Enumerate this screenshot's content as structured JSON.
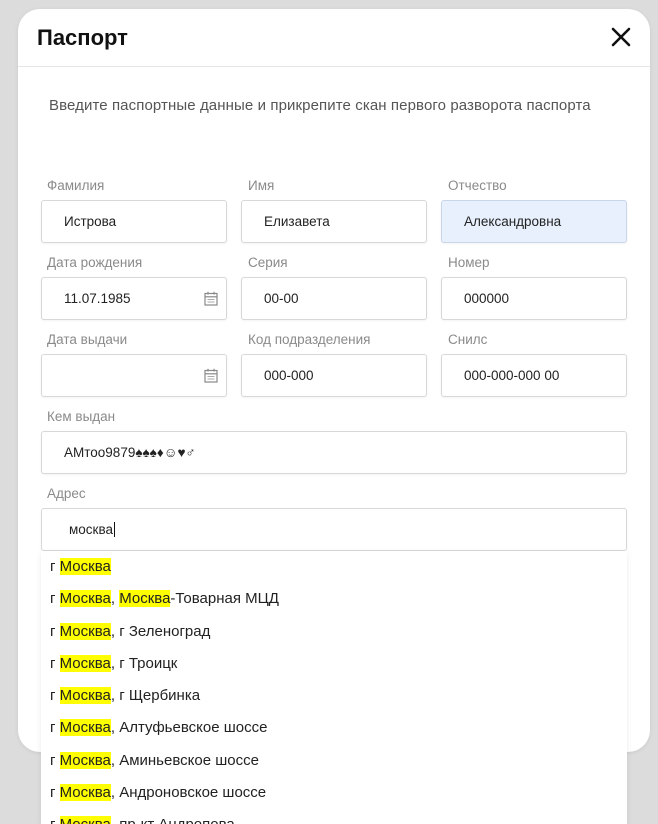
{
  "modal": {
    "title": "Паспорт",
    "subtitle": "Введите паспортные данные и прикрепите скан первого разворота паспорта"
  },
  "fields": {
    "surname": {
      "label": "Фамилия",
      "value": "Истрова"
    },
    "name": {
      "label": "Имя",
      "value": "Елизавета"
    },
    "patronymic": {
      "label": "Отчество",
      "value": "Александровна"
    },
    "birth_date": {
      "label": "Дата рождения",
      "value": "11.07.1985"
    },
    "series": {
      "label": "Серия",
      "value": "00-00"
    },
    "number": {
      "label": "Номер",
      "value": "000000"
    },
    "issue_date": {
      "label": "Дата выдачи",
      "value": ""
    },
    "division_code": {
      "label": "Код подразделения",
      "value": "000-000"
    },
    "snils": {
      "label": "Снилс",
      "value": "000-000-000 00"
    },
    "issued_by": {
      "label": "Кем выдан",
      "value": "АМтоо9879♠♠♠♦☺♥♂"
    },
    "address": {
      "label": "Адрес",
      "value": "москва"
    }
  },
  "suggestions": [
    {
      "prefix": "г ",
      "parts": [
        {
          "t": "Москва",
          "h": true
        }
      ]
    },
    {
      "prefix": "г ",
      "parts": [
        {
          "t": "Москва",
          "h": true
        },
        {
          "t": ", ",
          "h": false
        },
        {
          "t": "Москва",
          "h": true
        },
        {
          "t": "-Товарная МЦД",
          "h": false
        }
      ]
    },
    {
      "prefix": "г ",
      "parts": [
        {
          "t": "Москва",
          "h": true
        },
        {
          "t": ", г Зеленоград",
          "h": false
        }
      ]
    },
    {
      "prefix": "г ",
      "parts": [
        {
          "t": "Москва",
          "h": true
        },
        {
          "t": ", г Троицк",
          "h": false
        }
      ]
    },
    {
      "prefix": "г ",
      "parts": [
        {
          "t": "Москва",
          "h": true
        },
        {
          "t": ", г Щербинка",
          "h": false
        }
      ]
    },
    {
      "prefix": "г ",
      "parts": [
        {
          "t": "Москва",
          "h": true
        },
        {
          "t": ", Алтуфьевское шоссе",
          "h": false
        }
      ]
    },
    {
      "prefix": "г ",
      "parts": [
        {
          "t": "Москва",
          "h": true
        },
        {
          "t": ", Аминьевское шоссе",
          "h": false
        }
      ]
    },
    {
      "prefix": "г ",
      "parts": [
        {
          "t": "Москва",
          "h": true
        },
        {
          "t": ", Андроновское шоссе",
          "h": false
        }
      ]
    },
    {
      "prefix": "г ",
      "parts": [
        {
          "t": "Москва",
          "h": true
        },
        {
          "t": ", пр-кт Андропова",
          "h": false
        }
      ]
    }
  ],
  "colors": {
    "highlight": "#ffff00",
    "autofill_bg": "#e8f0fd"
  }
}
